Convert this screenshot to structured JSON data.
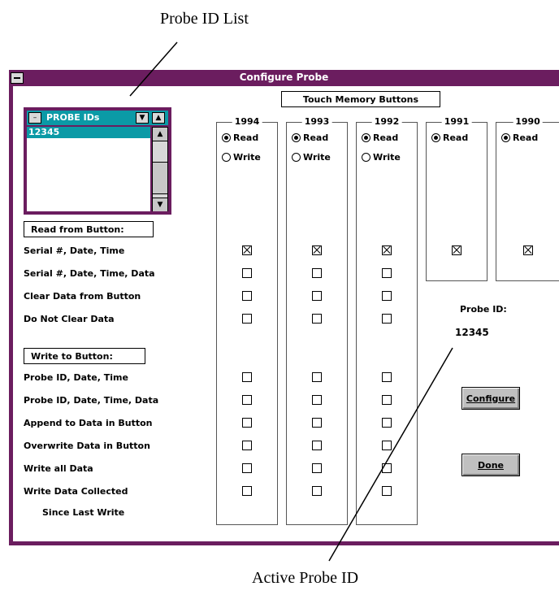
{
  "callouts": {
    "probe_id_list": "Probe ID List",
    "active_probe_id": "Active Probe ID"
  },
  "window": {
    "title": "Configure Probe",
    "colors": {
      "frame": "#6b1d5f",
      "accent": "#0b9aa6"
    }
  },
  "probe_panel": {
    "header": "PROBE IDs",
    "items": [
      "12345"
    ]
  },
  "touch_memory": {
    "label": "Touch Memory Buttons",
    "columns": [
      {
        "year": "1994",
        "read": "Read",
        "write": "Write",
        "mode": "read"
      },
      {
        "year": "1993",
        "read": "Read",
        "write": "Write",
        "mode": "read"
      },
      {
        "year": "1992",
        "read": "Read",
        "write": "Write",
        "mode": "read"
      },
      {
        "year": "1991",
        "read": "Read",
        "mode": "read"
      },
      {
        "year": "1990",
        "read": "Read",
        "mode": "read"
      }
    ]
  },
  "read_section": {
    "header": "Read from Button:",
    "options": [
      "Serial #, Date, Time",
      "Serial #, Date, Time, Data",
      "Clear Data from Button",
      "Do Not Clear Data"
    ]
  },
  "write_section": {
    "header": "Write to Button:",
    "options": [
      "Probe ID, Date, Time",
      "Probe ID, Date, Time, Data",
      "Append to Data in Button",
      "Overwrite Data in Button",
      "Write all Data",
      "Write Data Collected",
      "Since Last Write"
    ]
  },
  "probe_id": {
    "label": "Probe ID:",
    "value": "12345"
  },
  "buttons": {
    "configure": "Configure",
    "done": "Done"
  }
}
